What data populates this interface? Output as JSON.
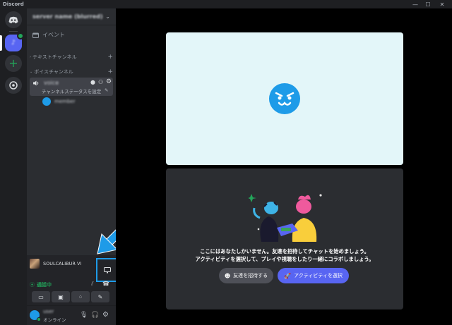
{
  "app": {
    "title": "Discord"
  },
  "window_controls": {
    "minimize": "—",
    "maximize": "☐",
    "close": "✕"
  },
  "server": {
    "name": "server name (blurred)"
  },
  "sidebar": {
    "events_label": "イベント",
    "text_category": "テキストチャンネル",
    "voice_category": "ボイスチャンネル",
    "voice_channel_name": "voice",
    "set_status_label": "チャンネルステータスを設定",
    "member_name": "member"
  },
  "activity": {
    "game_name": "SOULCALIBUR VI"
  },
  "voice_status": {
    "connected_label": "通話中"
  },
  "user": {
    "name": "user",
    "status": "オンライン"
  },
  "empty_state": {
    "line1": "ここにはあなたしかいません。友達を招待してチャットを始めましょう。",
    "line2": "アクティビティを選択して、プレイや視聴をしたり一緒にコラボしましょう。",
    "invite_button": "友達を招待する",
    "activity_button": "アクティビティを選択"
  },
  "colors": {
    "accent": "#5865f2",
    "green": "#23a55a",
    "highlight_blue": "#1e9be8",
    "tile_background": "#e3f6f9"
  }
}
